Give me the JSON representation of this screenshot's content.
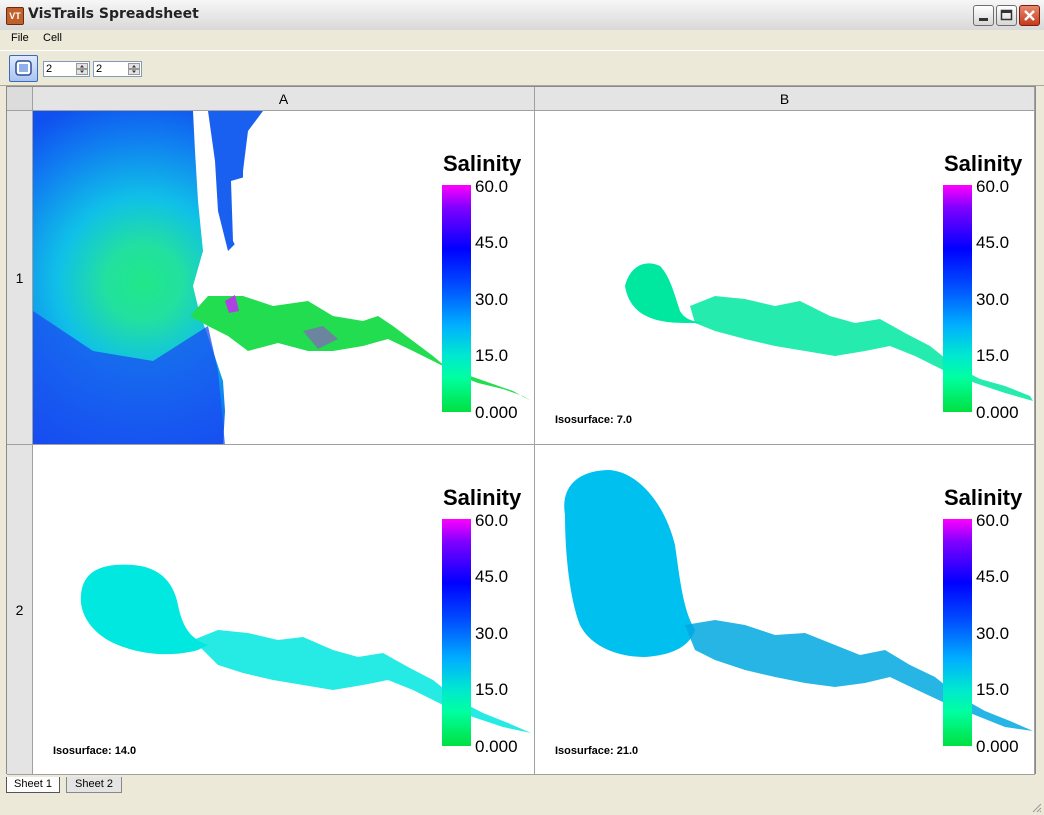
{
  "window": {
    "title": "VisTrails Spreadsheet",
    "icon": "vistrails-app-icon"
  },
  "menu": {
    "items": [
      "File",
      "Cell"
    ]
  },
  "toolbar": {
    "rows": "2",
    "columns": "2"
  },
  "grid": {
    "columns": [
      "A",
      "B"
    ],
    "rows": [
      "1",
      "2"
    ]
  },
  "legend": {
    "title": "Salinity",
    "ticks": [
      "60.0",
      "45.0",
      "30.0",
      "15.0",
      "0.000"
    ],
    "range": [
      0,
      60
    ],
    "colors": [
      "#ff00ff",
      "#0000ff",
      "#00b0ff",
      "#00ffa0",
      "#00e040"
    ]
  },
  "cells": {
    "A1": {
      "isosurface": ""
    },
    "B1": {
      "isosurface": "Isosurface: 7.0",
      "color": "#00e8a0"
    },
    "A2": {
      "isosurface": "Isosurface: 14.0",
      "color": "#00e8e0"
    },
    "B2": {
      "isosurface": "Isosurface: 21.0",
      "color": "#00c0f0"
    }
  },
  "tabs": [
    "Sheet 1",
    "Sheet 2"
  ]
}
